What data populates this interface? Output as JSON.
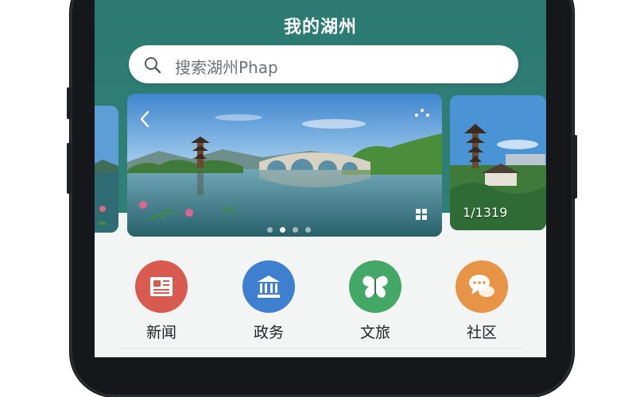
{
  "header": {
    "title": "我的湖州"
  },
  "search": {
    "placeholder": "搜索湖州Phap",
    "icon": "search-icon"
  },
  "carousel": {
    "active_index": 1,
    "dot_count": 4,
    "side_card_counter": "1/1319",
    "icons": [
      "back-icon",
      "more-icon",
      "grid-icon"
    ]
  },
  "quick_access": [
    {
      "label": "新闻",
      "icon": "newspaper-icon",
      "color": "#d95a4e"
    },
    {
      "label": "政务",
      "icon": "government-building-icon",
      "color": "#3f7fd0"
    },
    {
      "label": "文旅",
      "icon": "butterfly-icon",
      "color": "#43a765"
    },
    {
      "label": "社区",
      "icon": "chat-bubbles-icon",
      "color": "#e89446"
    }
  ],
  "colors": {
    "header": "#2f7f77",
    "background": "#f3f5f5"
  }
}
